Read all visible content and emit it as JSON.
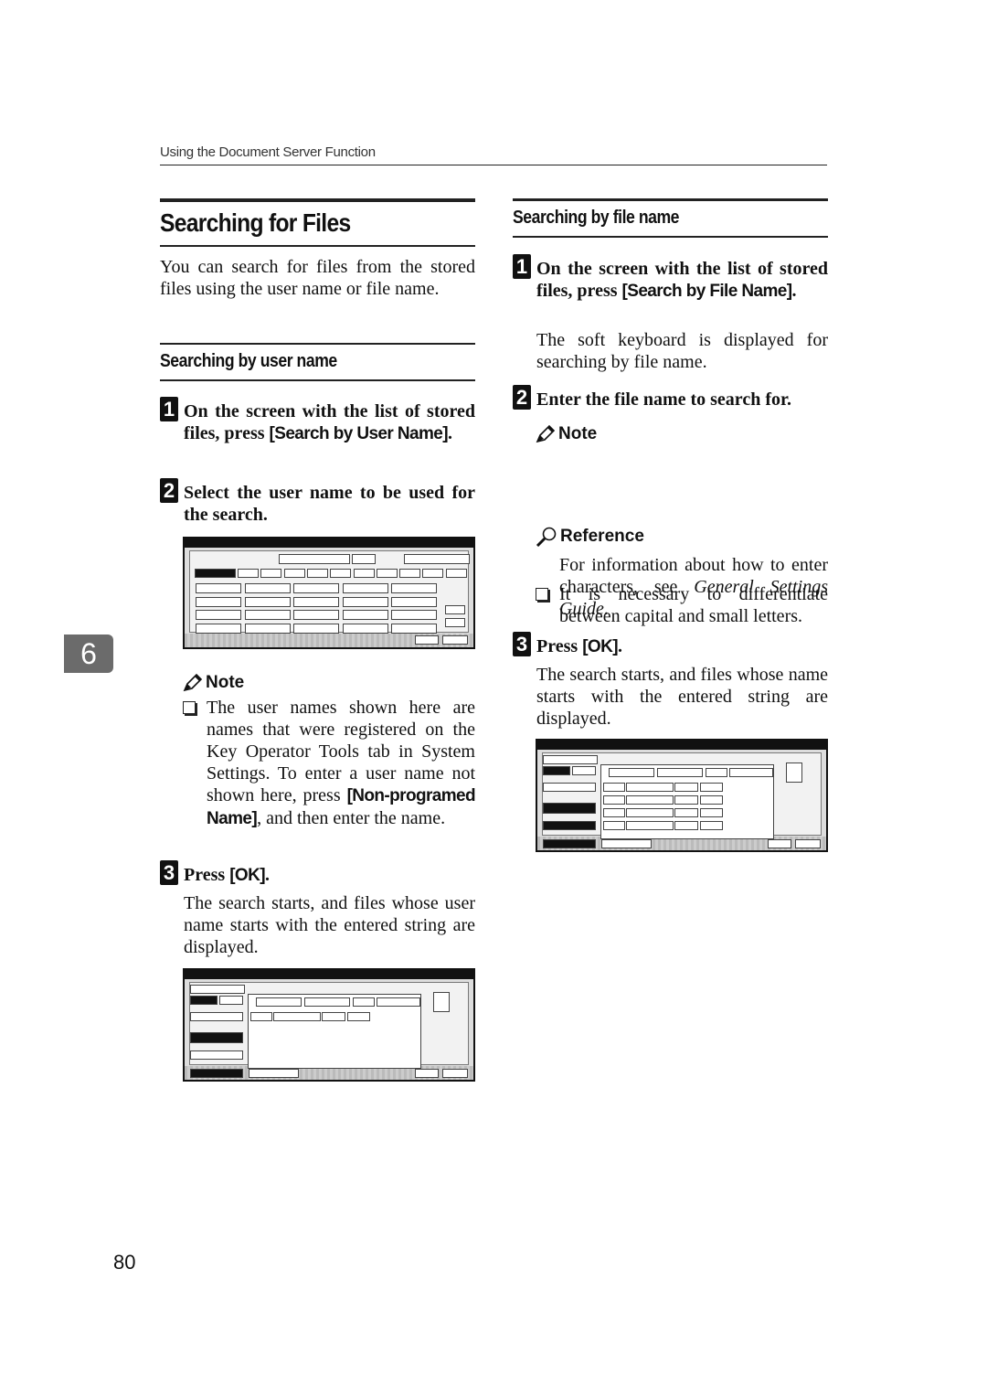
{
  "running_header": "Using the Document Server Function",
  "chapter_tab": "6",
  "page_number": "80",
  "left": {
    "title": "Searching for Files",
    "intro": "You can search for files from the stored files using the user name or file name.",
    "section_title": "Searching by user name",
    "steps": [
      {
        "num": "1",
        "text_pre": "On the screen with the list of stored files, press ",
        "button": "[Search by User Name]",
        "text_post": "."
      },
      {
        "num": "2",
        "text": "Select the user name to be used for the search."
      },
      {
        "num": "3",
        "text_pre": "Press ",
        "button": "[OK]",
        "text_post": ".",
        "result": "The search starts, and files whose user name starts with the entered string are displayed."
      }
    ],
    "note": {
      "heading": "Note",
      "icon": "pencil-icon",
      "bullet_pre": "The user names shown here are names that were registered on the Key Operator Tools tab in System Settings. To enter a user name not shown here, press ",
      "bullet_button": "[Non-programed Name]",
      "bullet_post": ", and then enter the name."
    }
  },
  "right": {
    "section_title": "Searching by file name",
    "steps": [
      {
        "num": "1",
        "text_pre": "On the screen with the list of stored files, press ",
        "button": "[Search by File Name]",
        "text_post": ".",
        "result": "The soft keyboard is displayed for searching by file name."
      },
      {
        "num": "2",
        "text": "Enter the file name to search for."
      },
      {
        "num": "3",
        "text_pre": "Press ",
        "button": "[OK]",
        "text_post": ".",
        "result": "The search starts, and files whose name starts with the entered string are displayed."
      }
    ],
    "note": {
      "heading": "Note",
      "icon": "pencil-icon",
      "bullet": "It is necessary to differentiate between capital and small letters."
    },
    "reference": {
      "heading": "Reference",
      "icon": "magnifier-icon",
      "text_pre": "For information about how to enter characters, see ",
      "text_italic": "General Settings Guide",
      "text_post": "."
    }
  },
  "colors": {
    "text": "#111111",
    "chapter_tab": "#6b6b6b"
  }
}
